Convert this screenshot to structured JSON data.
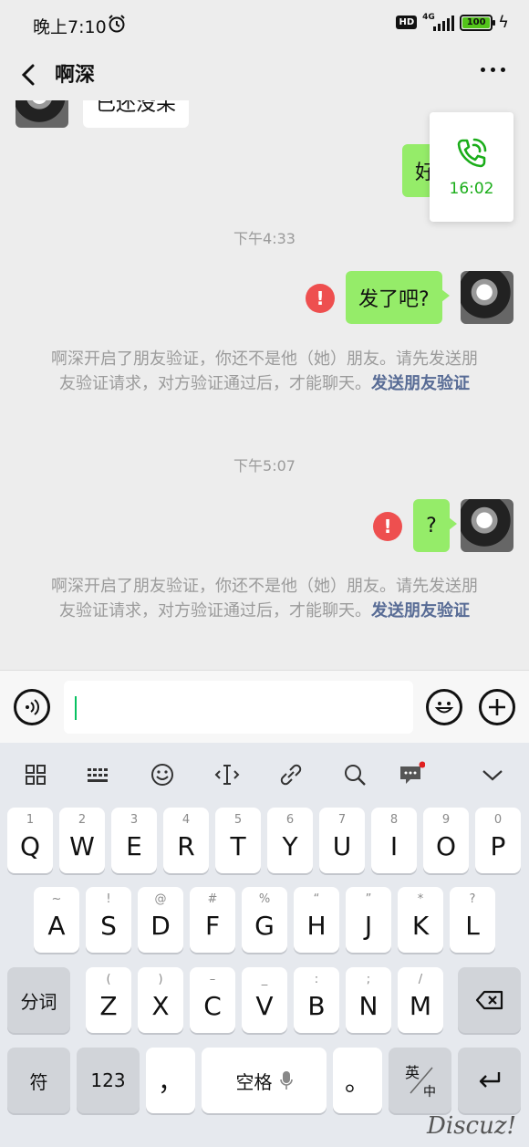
{
  "status_bar": {
    "time": "晚上7:10",
    "hd": "HD",
    "network": "4G",
    "battery": "100"
  },
  "header": {
    "title": "啊深"
  },
  "chat": {
    "partial_received_text": "已还没呆",
    "partial_sent_text": "好",
    "call_duration": "16:02",
    "ts1": "下午4:33",
    "msg1": "发了吧?",
    "ts2": "下午5:07",
    "msg2": "?",
    "sys_text": "啊深开启了朋友验证，你还不是他（她）朋友。请先发送朋友验证请求，对方验证通过后，才能聊天。",
    "sys_link": "发送朋友验证",
    "error_mark": "!"
  },
  "keyboard": {
    "row1": [
      {
        "sub": "1",
        "key": "Q"
      },
      {
        "sub": "2",
        "key": "W"
      },
      {
        "sub": "3",
        "key": "E"
      },
      {
        "sub": "4",
        "key": "R"
      },
      {
        "sub": "5",
        "key": "T"
      },
      {
        "sub": "6",
        "key": "Y"
      },
      {
        "sub": "7",
        "key": "U"
      },
      {
        "sub": "8",
        "key": "I"
      },
      {
        "sub": "9",
        "key": "O"
      },
      {
        "sub": "0",
        "key": "P"
      }
    ],
    "row2": [
      {
        "sub": "~",
        "key": "A"
      },
      {
        "sub": "!",
        "key": "S"
      },
      {
        "sub": "@",
        "key": "D"
      },
      {
        "sub": "#",
        "key": "F"
      },
      {
        "sub": "%",
        "key": "G"
      },
      {
        "sub": "“",
        "key": "H"
      },
      {
        "sub": "”",
        "key": "J"
      },
      {
        "sub": "*",
        "key": "K"
      },
      {
        "sub": "?",
        "key": "L"
      }
    ],
    "row3": [
      {
        "sub": "(",
        "key": "Z"
      },
      {
        "sub": ")",
        "key": "X"
      },
      {
        "sub": "–",
        "key": "C"
      },
      {
        "sub": "_",
        "key": "V"
      },
      {
        "sub": ":",
        "key": "B"
      },
      {
        "sub": ";",
        "key": "N"
      },
      {
        "sub": "/",
        "key": "M"
      }
    ],
    "fenci": "分词",
    "fu": "符",
    "num": "123",
    "comma": "，",
    "space": "空格",
    "period": "。",
    "lang_top": "英",
    "lang_bottom": "中"
  },
  "watermark": "Discuz!"
}
